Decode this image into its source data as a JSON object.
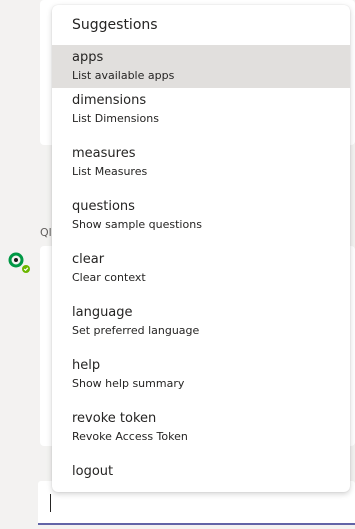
{
  "chat": {
    "bot_label": "Ql"
  },
  "suggestions": {
    "title": "Suggestions",
    "items": [
      {
        "command": "apps",
        "description": "List available apps",
        "selected": true
      },
      {
        "command": "dimensions",
        "description": "List Dimensions"
      },
      {
        "command": "measures",
        "description": "List Measures"
      },
      {
        "command": "questions",
        "description": "Show sample questions"
      },
      {
        "command": "clear",
        "description": "Clear context"
      },
      {
        "command": "language",
        "description": "Set preferred language"
      },
      {
        "command": "help",
        "description": "Show help summary"
      },
      {
        "command": "revoke token",
        "description": "Revoke Access Token"
      },
      {
        "command": "logout",
        "description": ""
      }
    ]
  },
  "compose": {
    "value": ""
  },
  "colors": {
    "accent": "#6264a7",
    "avatar_ring": "#009845",
    "status_ok": "#6bb700",
    "selected_bg": "#e1dfdd"
  },
  "icons": {
    "avatar": "qlik-bot-avatar-icon",
    "status": "available-status-icon"
  }
}
